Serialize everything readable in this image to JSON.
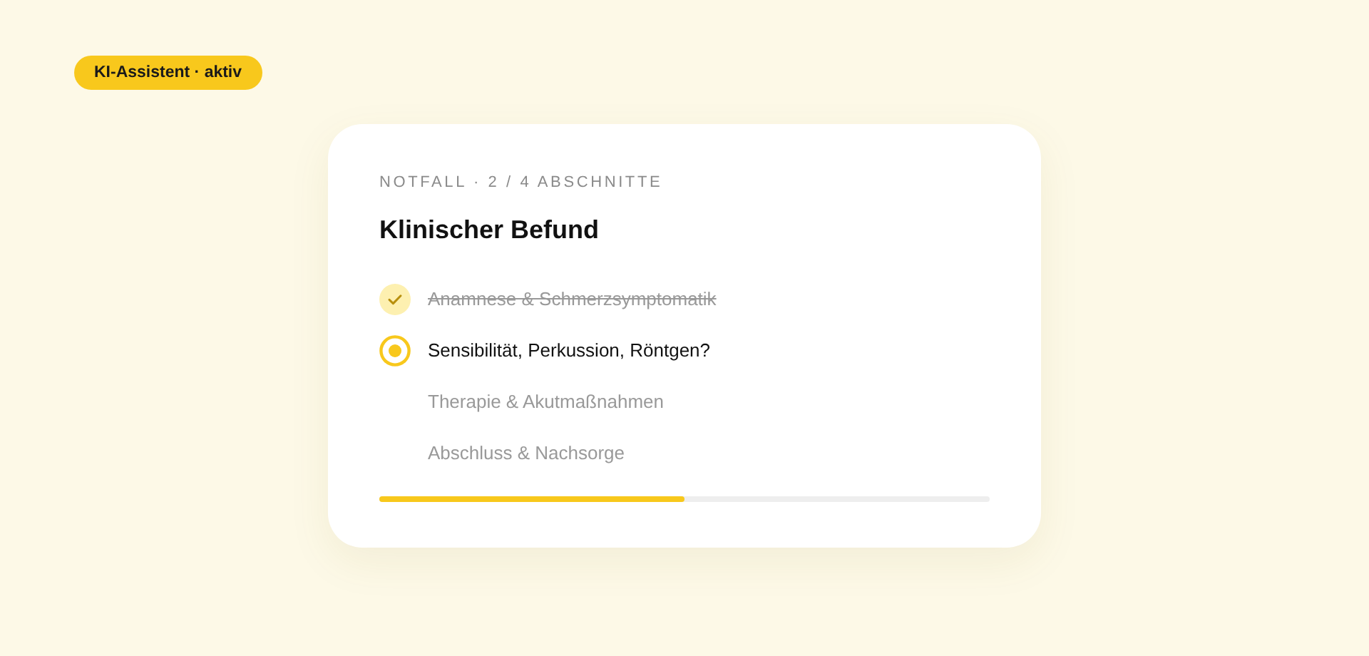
{
  "status_badge": "KI-Assistent · aktiv",
  "card": {
    "eyebrow": "NOTFALL · 2 / 4 ABSCHNITTE",
    "title": "Klinischer Befund",
    "steps": [
      {
        "label": "Anamnese & Schmerzsymptomatik",
        "checked": true,
        "selected": false
      },
      {
        "label": "Sensibilität, Perkussion, Röntgen?",
        "checked": false,
        "selected": true
      },
      {
        "label": "Therapie & Akutmaßnahmen",
        "checked": false,
        "selected": false
      },
      {
        "label": "Abschluss & Nachsorge",
        "checked": false,
        "selected": false
      }
    ],
    "progress": {
      "level": 0.5
    }
  }
}
